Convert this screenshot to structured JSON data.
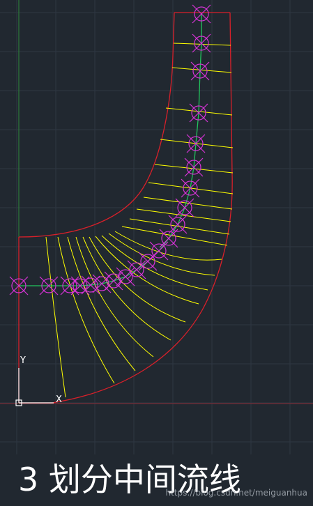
{
  "caption": "3 划分中间流线",
  "watermark": "https://blog.csdn.net/meiguanhua",
  "ucs": {
    "y_label": "Y",
    "x_label": "X"
  },
  "colors": {
    "background": "#212830",
    "grid": "#2e3742",
    "outline": "#d9202a",
    "stations": "#ffff00",
    "midline": "#22c55e",
    "nodes": "#d633d6",
    "axis_x": "#8a2a33",
    "axis_y": "#2f8a3b"
  },
  "icons": {
    "node_marker": "circle-x-marker",
    "ucs": "ucs-icon"
  }
}
